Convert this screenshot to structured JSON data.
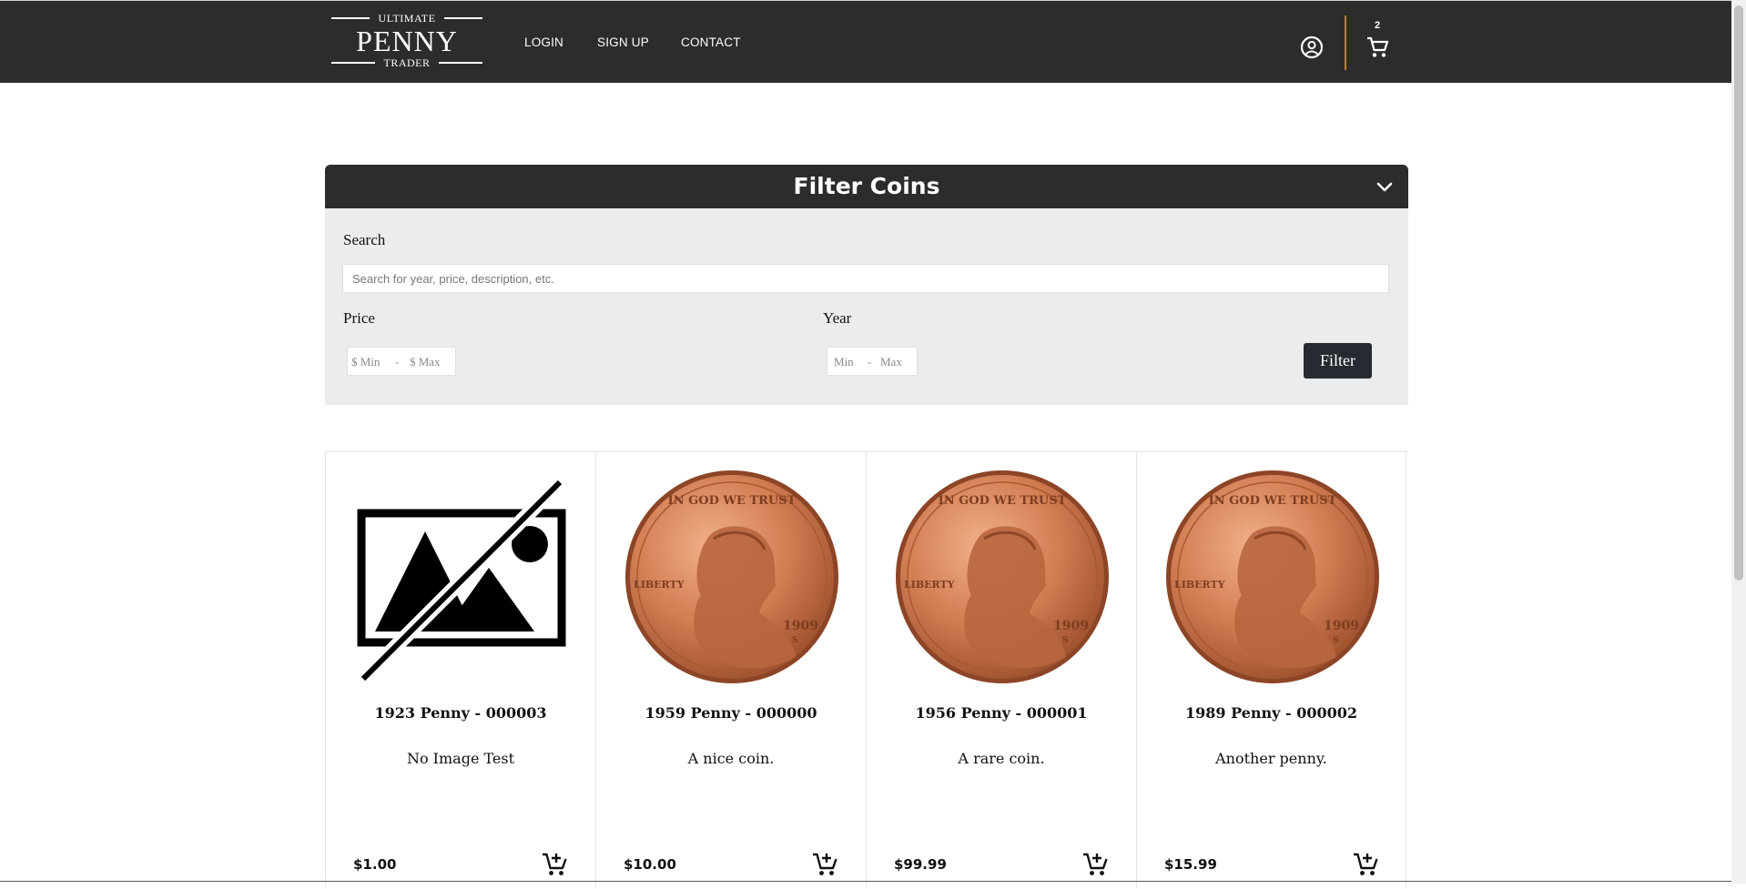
{
  "header": {
    "logo": {
      "top": "ULTIMATE",
      "main": "PENNY",
      "bottom": "TRADER"
    },
    "nav": [
      "LOGIN",
      "SIGN UP",
      "CONTACT"
    ],
    "cart_count": "2",
    "icons": {
      "account": "account-circle-icon",
      "cart": "cart-icon"
    }
  },
  "filter": {
    "title": "Filter Coins",
    "search_label": "Search",
    "search_placeholder": "Search for year, price, description, etc.",
    "price_label": "Price",
    "price_min": "$ Min",
    "price_sep": "-",
    "price_max": "$ Max",
    "year_label": "Year",
    "year_min": "Min",
    "year_sep": "-",
    "year_max": "Max",
    "button": "Filter"
  },
  "products": [
    {
      "title": "1923 Penny - 000003",
      "desc": "No Image Test",
      "price": "$1.00",
      "image": "no-image"
    },
    {
      "title": "1959 Penny - 000000",
      "desc": "A nice coin.",
      "price": "$10.00",
      "image": "penny"
    },
    {
      "title": "1956 Penny - 000001",
      "desc": "A rare coin.",
      "price": "$99.99",
      "image": "penny"
    },
    {
      "title": "1989 Penny - 000002",
      "desc": "Another penny.",
      "price": "$15.99",
      "image": "penny"
    }
  ],
  "coin": {
    "legend": "IN GOD WE TRUST",
    "liberty": "LIBERTY",
    "year": "1909",
    "mint": "S"
  },
  "colors": {
    "header_bg": "#2c2c2c",
    "panel_bg": "#ececec",
    "accent": "#b8860b",
    "button_bg": "#262b31",
    "copper": "#c8764f"
  }
}
